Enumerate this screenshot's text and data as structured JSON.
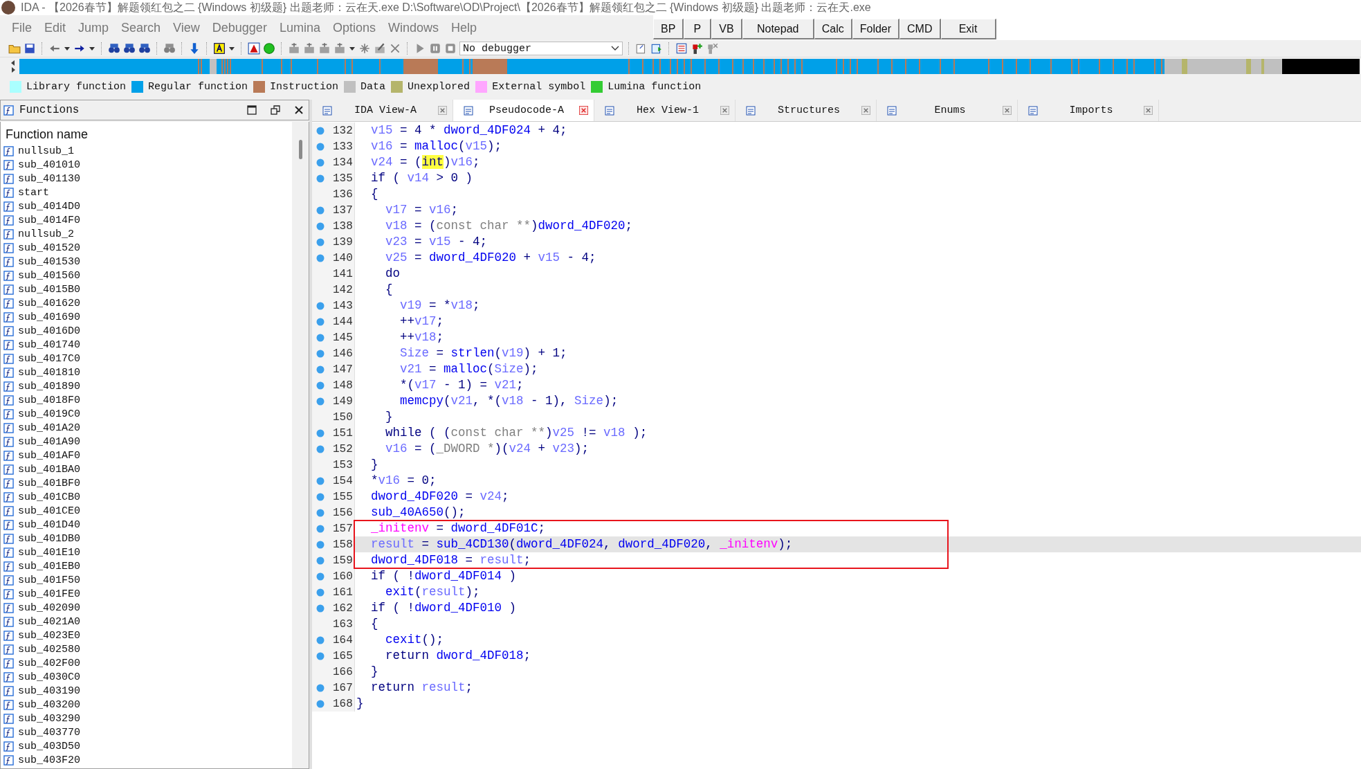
{
  "window": {
    "title": "IDA - 【2026春节】解题领红包之二 {Windows 初级题} 出题老师：云在天.exe D:\\Software\\OD\\Project\\【2026春节】解题领红包之二 {Windows 初级题} 出题老师：云在天.exe"
  },
  "menu": [
    "File",
    "Edit",
    "Jump",
    "Search",
    "View",
    "Debugger",
    "Lumina",
    "Options",
    "Windows",
    "Help"
  ],
  "quick_buttons": [
    "BP",
    "P",
    "VB",
    "Notepad",
    "Calc",
    "Folder",
    "CMD",
    "Exit"
  ],
  "debugger_select": {
    "value": "No debugger"
  },
  "legend": [
    {
      "label": "Library function",
      "color": "#aaffff"
    },
    {
      "label": "Regular function",
      "color": "#00a0e8"
    },
    {
      "label": "Instruction",
      "color": "#b97a57"
    },
    {
      "label": "Data",
      "color": "#c0c0c0"
    },
    {
      "label": "Unexplored",
      "color": "#b5b56b"
    },
    {
      "label": "External symbol",
      "color": "#ffa6ff"
    },
    {
      "label": "Lumina function",
      "color": "#33cc33"
    }
  ],
  "functions_panel": {
    "title": "Functions",
    "column": "Function name",
    "items": [
      "nullsub_1",
      "sub_401010",
      "sub_401130",
      "start",
      "sub_4014D0",
      "sub_4014F0",
      "nullsub_2",
      "sub_401520",
      "sub_401530",
      "sub_401560",
      "sub_4015B0",
      "sub_401620",
      "sub_401690",
      "sub_4016D0",
      "sub_401740",
      "sub_4017C0",
      "sub_401810",
      "sub_401890",
      "sub_4018F0",
      "sub_4019C0",
      "sub_401A20",
      "sub_401A90",
      "sub_401AF0",
      "sub_401BA0",
      "sub_401BF0",
      "sub_401CB0",
      "sub_401CE0",
      "sub_401D40",
      "sub_401DB0",
      "sub_401E10",
      "sub_401EB0",
      "sub_401F50",
      "sub_401FE0",
      "sub_402090",
      "sub_4021A0",
      "sub_4023E0",
      "sub_402580",
      "sub_402F00",
      "sub_4030C0",
      "sub_403190",
      "sub_403200",
      "sub_403290",
      "sub_403770",
      "sub_403D50",
      "sub_403F20"
    ]
  },
  "tabs": [
    {
      "label": "IDA View-A",
      "selected": false
    },
    {
      "label": "Pseudocode-A",
      "selected": true
    },
    {
      "label": "Hex View-1",
      "selected": false
    },
    {
      "label": "Structures",
      "selected": false
    },
    {
      "label": "Enums",
      "selected": false
    },
    {
      "label": "Imports",
      "selected": false
    }
  ],
  "code": {
    "lines": [
      {
        "number": "132",
        "breakpoint": true,
        "current": false,
        "boxed": false,
        "tokens": [
          {
            "kind": "local",
            "s": "  v15"
          },
          {
            "kind": "plain",
            "s": " = 4 * "
          },
          {
            "kind": "global",
            "s": "dword_4DF024"
          },
          {
            "kind": "plain",
            "s": " + 4;"
          }
        ]
      },
      {
        "number": "133",
        "breakpoint": true,
        "current": false,
        "boxed": false,
        "tokens": [
          {
            "kind": "local",
            "s": "  v16"
          },
          {
            "kind": "plain",
            "s": " = "
          },
          {
            "kind": "global",
            "s": "malloc"
          },
          {
            "kind": "plain",
            "s": "("
          },
          {
            "kind": "local",
            "s": "v15"
          },
          {
            "kind": "plain",
            "s": ");"
          }
        ]
      },
      {
        "number": "134",
        "breakpoint": true,
        "current": false,
        "boxed": false,
        "tokens": [
          {
            "kind": "local",
            "s": "  v24"
          },
          {
            "kind": "plain",
            "s": " = ("
          },
          {
            "kind": "highlight",
            "s": "int"
          },
          {
            "kind": "plain",
            "s": ")"
          },
          {
            "kind": "local",
            "s": "v16"
          },
          {
            "kind": "plain",
            "s": ";"
          }
        ]
      },
      {
        "number": "135",
        "breakpoint": true,
        "current": false,
        "boxed": false,
        "tokens": [
          {
            "kind": "plain",
            "s": "  if ( "
          },
          {
            "kind": "local",
            "s": "v14"
          },
          {
            "kind": "plain",
            "s": " > 0 )"
          }
        ]
      },
      {
        "number": "136",
        "breakpoint": false,
        "current": false,
        "boxed": false,
        "tokens": [
          {
            "kind": "plain",
            "s": "  {"
          }
        ]
      },
      {
        "number": "137",
        "breakpoint": true,
        "current": false,
        "boxed": false,
        "tokens": [
          {
            "kind": "local",
            "s": "    v17"
          },
          {
            "kind": "plain",
            "s": " = "
          },
          {
            "kind": "local",
            "s": "v16"
          },
          {
            "kind": "plain",
            "s": ";"
          }
        ]
      },
      {
        "number": "138",
        "breakpoint": true,
        "current": false,
        "boxed": false,
        "tokens": [
          {
            "kind": "local",
            "s": "    v18"
          },
          {
            "kind": "plain",
            "s": " = ("
          },
          {
            "kind": "type",
            "s": "const char **"
          },
          {
            "kind": "plain",
            "s": ")"
          },
          {
            "kind": "global",
            "s": "dword_4DF020"
          },
          {
            "kind": "plain",
            "s": ";"
          }
        ]
      },
      {
        "number": "139",
        "breakpoint": true,
        "current": false,
        "boxed": false,
        "tokens": [
          {
            "kind": "local",
            "s": "    v23"
          },
          {
            "kind": "plain",
            "s": " = "
          },
          {
            "kind": "local",
            "s": "v15"
          },
          {
            "kind": "plain",
            "s": " - 4;"
          }
        ]
      },
      {
        "number": "140",
        "breakpoint": true,
        "current": false,
        "boxed": false,
        "tokens": [
          {
            "kind": "local",
            "s": "    v25"
          },
          {
            "kind": "plain",
            "s": " = "
          },
          {
            "kind": "global",
            "s": "dword_4DF020"
          },
          {
            "kind": "plain",
            "s": " + "
          },
          {
            "kind": "local",
            "s": "v15"
          },
          {
            "kind": "plain",
            "s": " - 4;"
          }
        ]
      },
      {
        "number": "141",
        "breakpoint": false,
        "current": false,
        "boxed": false,
        "tokens": [
          {
            "kind": "plain",
            "s": "    do"
          }
        ]
      },
      {
        "number": "142",
        "breakpoint": false,
        "current": false,
        "boxed": false,
        "tokens": [
          {
            "kind": "plain",
            "s": "    {"
          }
        ]
      },
      {
        "number": "143",
        "breakpoint": true,
        "current": false,
        "boxed": false,
        "tokens": [
          {
            "kind": "local",
            "s": "      v19"
          },
          {
            "kind": "plain",
            "s": " = *"
          },
          {
            "kind": "local",
            "s": "v18"
          },
          {
            "kind": "plain",
            "s": ";"
          }
        ]
      },
      {
        "number": "144",
        "breakpoint": true,
        "current": false,
        "boxed": false,
        "tokens": [
          {
            "kind": "plain",
            "s": "      ++"
          },
          {
            "kind": "local",
            "s": "v17"
          },
          {
            "kind": "plain",
            "s": ";"
          }
        ]
      },
      {
        "number": "145",
        "breakpoint": true,
        "current": false,
        "boxed": false,
        "tokens": [
          {
            "kind": "plain",
            "s": "      ++"
          },
          {
            "kind": "local",
            "s": "v18"
          },
          {
            "kind": "plain",
            "s": ";"
          }
        ]
      },
      {
        "number": "146",
        "breakpoint": true,
        "current": false,
        "boxed": false,
        "tokens": [
          {
            "kind": "local",
            "s": "      Size"
          },
          {
            "kind": "plain",
            "s": " = "
          },
          {
            "kind": "global",
            "s": "strlen"
          },
          {
            "kind": "plain",
            "s": "("
          },
          {
            "kind": "local",
            "s": "v19"
          },
          {
            "kind": "plain",
            "s": ") + 1;"
          }
        ]
      },
      {
        "number": "147",
        "breakpoint": true,
        "current": false,
        "boxed": false,
        "tokens": [
          {
            "kind": "local",
            "s": "      v21"
          },
          {
            "kind": "plain",
            "s": " = "
          },
          {
            "kind": "global",
            "s": "malloc"
          },
          {
            "kind": "plain",
            "s": "("
          },
          {
            "kind": "local",
            "s": "Size"
          },
          {
            "kind": "plain",
            "s": ");"
          }
        ]
      },
      {
        "number": "148",
        "breakpoint": true,
        "current": false,
        "boxed": false,
        "tokens": [
          {
            "kind": "plain",
            "s": "      *("
          },
          {
            "kind": "local",
            "s": "v17"
          },
          {
            "kind": "plain",
            "s": " - 1) = "
          },
          {
            "kind": "local",
            "s": "v21"
          },
          {
            "kind": "plain",
            "s": ";"
          }
        ]
      },
      {
        "number": "149",
        "breakpoint": true,
        "current": false,
        "boxed": false,
        "tokens": [
          {
            "kind": "global",
            "s": "      memcpy"
          },
          {
            "kind": "plain",
            "s": "("
          },
          {
            "kind": "local",
            "s": "v21"
          },
          {
            "kind": "plain",
            "s": ", *("
          },
          {
            "kind": "local",
            "s": "v18"
          },
          {
            "kind": "plain",
            "s": " - 1), "
          },
          {
            "kind": "local",
            "s": "Size"
          },
          {
            "kind": "plain",
            "s": ");"
          }
        ]
      },
      {
        "number": "150",
        "breakpoint": false,
        "current": false,
        "boxed": false,
        "tokens": [
          {
            "kind": "plain",
            "s": "    }"
          }
        ]
      },
      {
        "number": "151",
        "breakpoint": true,
        "current": false,
        "boxed": false,
        "tokens": [
          {
            "kind": "plain",
            "s": "    while ( ("
          },
          {
            "kind": "type",
            "s": "const char **"
          },
          {
            "kind": "plain",
            "s": ")"
          },
          {
            "kind": "local",
            "s": "v25"
          },
          {
            "kind": "plain",
            "s": " != "
          },
          {
            "kind": "local",
            "s": "v18"
          },
          {
            "kind": "plain",
            "s": " );"
          }
        ]
      },
      {
        "number": "152",
        "breakpoint": true,
        "current": false,
        "boxed": false,
        "tokens": [
          {
            "kind": "local",
            "s": "    v16"
          },
          {
            "kind": "plain",
            "s": " = ("
          },
          {
            "kind": "type",
            "s": "_DWORD *"
          },
          {
            "kind": "plain",
            "s": ")("
          },
          {
            "kind": "local",
            "s": "v24"
          },
          {
            "kind": "plain",
            "s": " + "
          },
          {
            "kind": "local",
            "s": "v23"
          },
          {
            "kind": "plain",
            "s": ");"
          }
        ]
      },
      {
        "number": "153",
        "breakpoint": false,
        "current": false,
        "boxed": false,
        "tokens": [
          {
            "kind": "plain",
            "s": "  }"
          }
        ]
      },
      {
        "number": "154",
        "breakpoint": true,
        "current": false,
        "boxed": false,
        "tokens": [
          {
            "kind": "plain",
            "s": "  *"
          },
          {
            "kind": "local",
            "s": "v16"
          },
          {
            "kind": "plain",
            "s": " = 0;"
          }
        ]
      },
      {
        "number": "155",
        "breakpoint": true,
        "current": false,
        "boxed": false,
        "tokens": [
          {
            "kind": "global",
            "s": "  dword_4DF020"
          },
          {
            "kind": "plain",
            "s": " = "
          },
          {
            "kind": "local",
            "s": "v24"
          },
          {
            "kind": "plain",
            "s": ";"
          }
        ]
      },
      {
        "number": "156",
        "breakpoint": true,
        "current": false,
        "boxed": false,
        "tokens": [
          {
            "kind": "global",
            "s": "  sub_40A650"
          },
          {
            "kind": "plain",
            "s": "();"
          }
        ]
      },
      {
        "number": "157",
        "breakpoint": true,
        "current": false,
        "boxed": true,
        "tokens": [
          {
            "kind": "special",
            "s": "  _initenv"
          },
          {
            "kind": "plain",
            "s": " = "
          },
          {
            "kind": "global",
            "s": "dword_4DF01C"
          },
          {
            "kind": "plain",
            "s": ";"
          }
        ]
      },
      {
        "number": "158",
        "breakpoint": true,
        "current": true,
        "boxed": true,
        "tokens": [
          {
            "kind": "local",
            "s": "  result"
          },
          {
            "kind": "plain",
            "s": " = "
          },
          {
            "kind": "global",
            "s": "sub_4CD130"
          },
          {
            "kind": "plain",
            "s": "("
          },
          {
            "kind": "global",
            "s": "dword_4DF024"
          },
          {
            "kind": "plain",
            "s": ", "
          },
          {
            "kind": "global",
            "s": "dword_4DF020"
          },
          {
            "kind": "plain",
            "s": ", "
          },
          {
            "kind": "special",
            "s": "_initenv"
          },
          {
            "kind": "plain",
            "s": ");"
          }
        ]
      },
      {
        "number": "159",
        "breakpoint": true,
        "current": false,
        "boxed": true,
        "tokens": [
          {
            "kind": "global",
            "s": "  dword_4DF018"
          },
          {
            "kind": "plain",
            "s": " = "
          },
          {
            "kind": "local",
            "s": "result"
          },
          {
            "kind": "plain",
            "s": ";"
          }
        ]
      },
      {
        "number": "160",
        "breakpoint": true,
        "current": false,
        "boxed": false,
        "tokens": [
          {
            "kind": "plain",
            "s": "  if ( !"
          },
          {
            "kind": "global",
            "s": "dword_4DF014"
          },
          {
            "kind": "plain",
            "s": " )"
          }
        ]
      },
      {
        "number": "161",
        "breakpoint": true,
        "current": false,
        "boxed": false,
        "tokens": [
          {
            "kind": "global",
            "s": "    exit"
          },
          {
            "kind": "plain",
            "s": "("
          },
          {
            "kind": "local",
            "s": "result"
          },
          {
            "kind": "plain",
            "s": ");"
          }
        ]
      },
      {
        "number": "162",
        "breakpoint": true,
        "current": false,
        "boxed": false,
        "tokens": [
          {
            "kind": "plain",
            "s": "  if ( !"
          },
          {
            "kind": "global",
            "s": "dword_4DF010"
          },
          {
            "kind": "plain",
            "s": " )"
          }
        ]
      },
      {
        "number": "163",
        "breakpoint": false,
        "current": false,
        "boxed": false,
        "tokens": [
          {
            "kind": "plain",
            "s": "  {"
          }
        ]
      },
      {
        "number": "164",
        "breakpoint": true,
        "current": false,
        "boxed": false,
        "tokens": [
          {
            "kind": "global",
            "s": "    cexit"
          },
          {
            "kind": "plain",
            "s": "();"
          }
        ]
      },
      {
        "number": "165",
        "breakpoint": true,
        "current": false,
        "boxed": false,
        "tokens": [
          {
            "kind": "plain",
            "s": "    return "
          },
          {
            "kind": "global",
            "s": "dword_4DF018"
          },
          {
            "kind": "plain",
            "s": ";"
          }
        ]
      },
      {
        "number": "166",
        "breakpoint": false,
        "current": false,
        "boxed": false,
        "tokens": [
          {
            "kind": "plain",
            "s": "  }"
          }
        ]
      },
      {
        "number": "167",
        "breakpoint": true,
        "current": false,
        "boxed": false,
        "tokens": [
          {
            "kind": "plain",
            "s": "  return "
          },
          {
            "kind": "local",
            "s": "result"
          },
          {
            "kind": "plain",
            "s": ";"
          }
        ]
      },
      {
        "number": "168",
        "breakpoint": true,
        "current": false,
        "boxed": false,
        "tokens": [
          {
            "kind": "plain",
            "s": "}"
          }
        ]
      }
    ]
  }
}
